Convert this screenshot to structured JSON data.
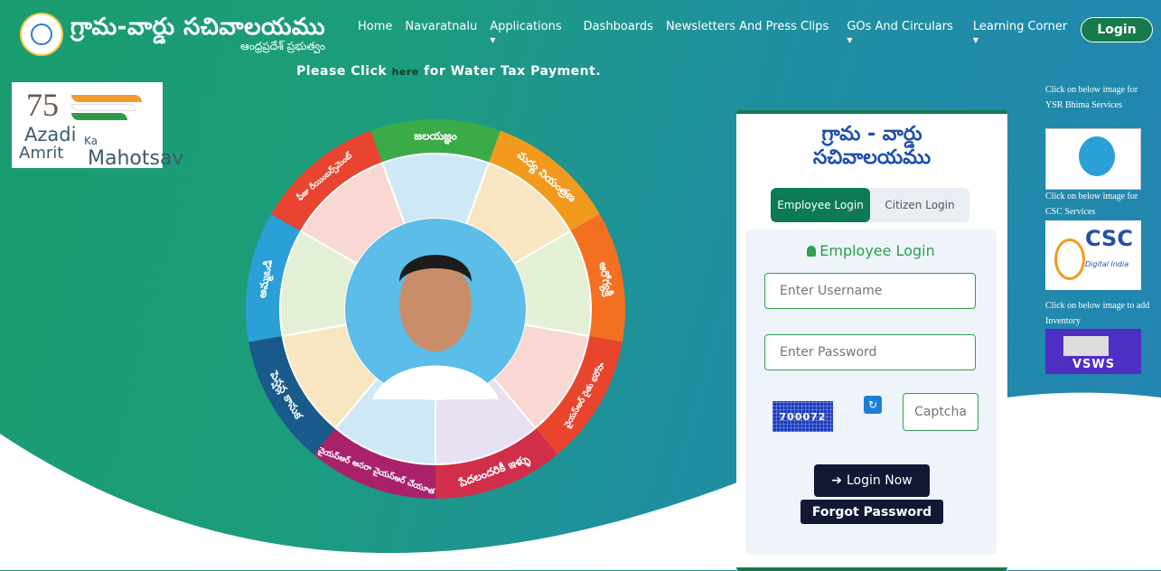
{
  "header": {
    "logo_title": "గ్రామ-వార్డు సచివాలయము",
    "logo_subtitle": "ఆంధ్రప్రదేశ్ ప్రభుత్వం",
    "nav": [
      {
        "label": "Home",
        "dropdown": false
      },
      {
        "label": "Navaratnalu",
        "dropdown": false
      },
      {
        "label": "Applications",
        "dropdown": true
      },
      {
        "label": "Dashboards",
        "dropdown": false
      },
      {
        "label": "Newsletters And Press Clips",
        "dropdown": false
      },
      {
        "label": "GOs And Circulars",
        "dropdown": true
      },
      {
        "label": "Learning Corner",
        "dropdown": true
      }
    ],
    "login_label": "Login"
  },
  "banner": {
    "prefix": "Please Click ",
    "link": "here",
    "suffix": " for Water Tax Payment."
  },
  "azadi": {
    "num": "75",
    "line1": "Azadi",
    "ka": "Ka",
    "line2": "Amrit",
    "line3": "Mahotsav"
  },
  "wheel": {
    "segments": [
      {
        "label": "జలయజ్ఞం",
        "color": "#3bab48"
      },
      {
        "label": "మద్య నియంత్రణ",
        "color": "#f29a1e"
      },
      {
        "label": "ఆరోగ్యశ్రీ",
        "color": "#f37021"
      },
      {
        "label": "వైయస్ఆర్ రైతు భరోసా",
        "color": "#e8452c"
      },
      {
        "label": "పేదలందరికీ ఇళ్ళు",
        "color": "#d12e4a"
      },
      {
        "label": "వైయస్ఆర్ ఆసరా వైయస్ఆర్ చేయూత",
        "color": "#a9216b"
      },
      {
        "label": "పెన్షన్ల కానుక",
        "color": "#1a5a8a"
      },
      {
        "label": "అమ్మఒడి",
        "color": "#2aa0d6"
      },
      {
        "label": "ఫీజు రీయింబర్స్‌మెంట్",
        "color": "#e8442f"
      }
    ]
  },
  "login_card": {
    "title_line1": "గ్రామ - వార్డు",
    "title_line2": "సచివాలయము",
    "tab_employee": "Employee Login",
    "tab_citizen": "Citizen Login",
    "section_title": "Employee Login",
    "username_placeholder": "Enter Username",
    "password_placeholder": "Enter Password",
    "captcha_text": "700072",
    "captcha_placeholder": "Captcha",
    "login_now": "Login Now",
    "forgot": "Forgot Password"
  },
  "side": {
    "ysr_caption": "Click on below image for YSR Bhima Services",
    "csc_caption": "Click on below image for CSC Services",
    "inv_caption": "Click on below image to add Inventory",
    "csc_logo": "CSC",
    "csc_sub": "Digital India",
    "vsws": "VSWS"
  },
  "colors": {
    "brand_green": "#167a4c",
    "dark_button": "#121833",
    "accent_blue": "#1e4fb0"
  }
}
